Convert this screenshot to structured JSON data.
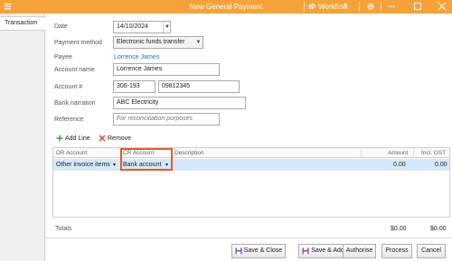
{
  "window": {
    "title": "New General Payment",
    "workflow_label": "Workflow"
  },
  "tabs": [
    {
      "label": "Transaction"
    }
  ],
  "form": {
    "date_label": "Date",
    "date_value": "14/10/2024",
    "payment_method_label": "Payment method",
    "payment_method_value": "Electronic funds transfer",
    "payee_label": "Payee",
    "payee_value": "Lorrence James",
    "account_name_label": "Account name",
    "account_name_value": "Lorrence James",
    "account_no_label": "Account #",
    "bsb_value": "306-193",
    "account_no_value": "09812345",
    "bank_narration_label": "Bank narration",
    "bank_narration_value": "ABC Electricity",
    "reference_label": "Reference",
    "reference_placeholder": "For reconciliation purposes"
  },
  "line_toolbar": {
    "add_line_label": "Add Line",
    "remove_label": "Remove"
  },
  "grid": {
    "headers": {
      "dr_account": "DR Account",
      "cr_account": "CR Account",
      "description": "Description",
      "amount": "Amount",
      "incl_gst": "Incl. GST"
    },
    "rows": [
      {
        "dr_account": "Other invoice items",
        "cr_account": "Bank account",
        "description": "",
        "amount": "0.00",
        "incl_gst": "0.00"
      }
    ]
  },
  "totals": {
    "label": "Totals",
    "amount": "$0.00",
    "incl_gst": "$0.00"
  },
  "buttons": {
    "save_close": "Save & Close",
    "save_add": "Save & Add",
    "authorise": "Authorise",
    "process": "Process",
    "cancel": "Cancel"
  },
  "colors": {
    "titlebar": "#f5a23b",
    "highlight": "#e8582a",
    "selected_row": "#d6e9fa",
    "link": "#1f6fbf"
  }
}
